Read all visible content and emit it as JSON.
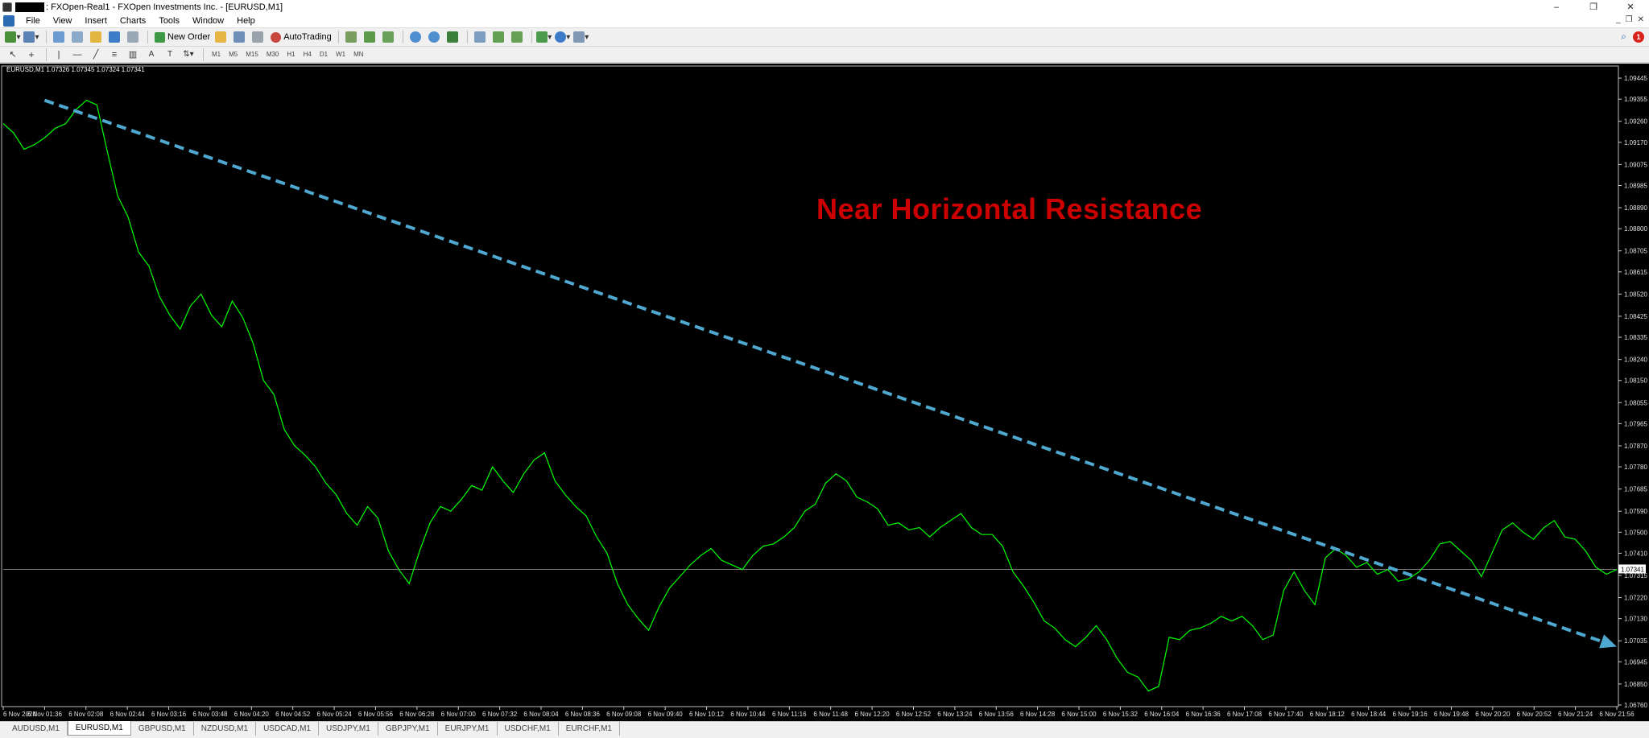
{
  "window": {
    "title": ": FXOpen-Real1 - FXOpen Investments Inc. - [EURUSD,M1]",
    "minimize": "–",
    "restore": "❐",
    "close": "✕"
  },
  "menu": [
    "File",
    "View",
    "Insert",
    "Charts",
    "Tools",
    "Window",
    "Help"
  ],
  "toolbar": {
    "new_order": "New Order",
    "auto_trading": "AutoTrading",
    "notification_count": "1"
  },
  "timeframes": [
    "M1",
    "M5",
    "M15",
    "M30",
    "H1",
    "H4",
    "D1",
    "W1",
    "MN"
  ],
  "chart_header": "EURUSD,M1  1.07326 1.07345 1.07324 1.07341",
  "annotation": "Near Horizontal Resistance",
  "chart_data": {
    "type": "line",
    "symbol": "EURUSD,M1",
    "current_price": "1.07341",
    "price_levels": [
      "1.09445",
      "1.09355",
      "1.09260",
      "1.09170",
      "1.09075",
      "1.08985",
      "1.08890",
      "1.08800",
      "1.08705",
      "1.08615",
      "1.08520",
      "1.08425",
      "1.08335",
      "1.08240",
      "1.08150",
      "1.08055",
      "1.07965",
      "1.07870",
      "1.07780",
      "1.07685",
      "1.07590",
      "1.07500",
      "1.07410",
      "1.07315",
      "1.07220",
      "1.07130",
      "1.07035",
      "1.06945",
      "1.06850",
      "1.06760"
    ],
    "time_labels": [
      "6 Nov 2024",
      "6 Nov 01:36",
      "6 Nov 02:08",
      "6 Nov 02:44",
      "6 Nov 03:16",
      "6 Nov 03:48",
      "6 Nov 04:20",
      "6 Nov 04:52",
      "6 Nov 05:24",
      "6 Nov 05:56",
      "6 Nov 06:28",
      "6 Nov 07:00",
      "6 Nov 07:32",
      "6 Nov 08:04",
      "6 Nov 08:36",
      "6 Nov 09:08",
      "6 Nov 09:40",
      "6 Nov 10:12",
      "6 Nov 10:44",
      "6 Nov 11:16",
      "6 Nov 11:48",
      "6 Nov 12:20",
      "6 Nov 12:52",
      "6 Nov 13:24",
      "6 Nov 13:56",
      "6 Nov 14:28",
      "6 Nov 15:00",
      "6 Nov 15:32",
      "6 Nov 16:04",
      "6 Nov 16:36",
      "6 Nov 17:08",
      "6 Nov 17:40",
      "6 Nov 18:12",
      "6 Nov 18:44",
      "6 Nov 19:16",
      "6 Nov 19:48",
      "6 Nov 20:20",
      "6 Nov 20:52",
      "6 Nov 21:24",
      "6 Nov 21:56"
    ],
    "ylim": [
      1.0676,
      1.0949
    ],
    "series": [
      {
        "values": [
          1.0925,
          1.0921,
          1.0914,
          1.0916,
          1.0919,
          1.0923,
          1.0925,
          1.0931,
          1.0935,
          1.0933,
          1.0913,
          1.0894,
          1.0885,
          1.087,
          1.0864,
          1.0851,
          1.0843,
          1.0837,
          1.0847,
          1.0852,
          1.0843,
          1.0838,
          1.0849,
          1.0842,
          1.0831,
          1.0815,
          1.0809,
          1.0794,
          1.0787,
          1.0783,
          1.0778,
          1.0771,
          1.0766,
          1.0758,
          1.0753,
          1.0761,
          1.0756,
          1.0742,
          1.0734,
          1.0728,
          1.0742,
          1.0754,
          1.0761,
          1.0759,
          1.0764,
          1.077,
          1.0768,
          1.0778,
          1.0772,
          1.0767,
          1.0775,
          1.0781,
          1.0784,
          1.0772,
          1.0766,
          1.0761,
          1.0757,
          1.0748,
          1.0741,
          1.0728,
          1.0719,
          1.0713,
          1.0708,
          1.0718,
          1.0726,
          1.0731,
          1.0736,
          1.074,
          1.0743,
          1.0738,
          1.0736,
          1.0734,
          1.074,
          1.0744,
          1.0745,
          1.0748,
          1.0752,
          1.0759,
          1.0762,
          1.0771,
          1.0775,
          1.0772,
          1.0765,
          1.0763,
          1.076,
          1.0753,
          1.0754,
          1.0751,
          1.0752,
          1.0748,
          1.0752,
          1.0755,
          1.0758,
          1.0752,
          1.0749,
          1.0749,
          1.0744,
          1.0733,
          1.0727,
          1.072,
          1.0712,
          1.0709,
          1.0704,
          1.0701,
          1.0705,
          1.071,
          1.0704,
          1.0696,
          1.069,
          1.0688,
          1.0682,
          1.0684,
          1.0705,
          1.0704,
          1.0708,
          1.0709,
          1.0711,
          1.0714,
          1.0712,
          1.0714,
          1.071,
          1.0704,
          1.0706,
          1.0725,
          1.0733,
          1.0725,
          1.0719,
          1.0739,
          1.0743,
          1.074,
          1.0735,
          1.0737,
          1.0732,
          1.0734,
          1.0729,
          1.073,
          1.0733,
          1.0738,
          1.0745,
          1.0746,
          1.0742,
          1.0738,
          1.0731,
          1.0741,
          1.0751,
          1.0754,
          1.075,
          1.0747,
          1.0752,
          1.0755,
          1.0748,
          1.0747,
          1.0742,
          1.0735,
          1.0732,
          1.0734
        ]
      }
    ],
    "trendline": {
      "start": [
        "6 Nov 01:36",
        1.0935
      ],
      "end": [
        "6 Nov 21:56",
        1.0701
      ],
      "style": "dashed",
      "arrow": true
    }
  },
  "tabs": [
    "AUDUSD,M1",
    "EURUSD,M1",
    "GBPUSD,M1",
    "NZDUSD,M1",
    "USDCAD,M1",
    "USDJPY,M1",
    "GBPJPY,M1",
    "EURJPY,M1",
    "USDCHF,M1",
    "EURCHF,M1"
  ],
  "active_tab": "EURUSD,M1",
  "colors": {
    "chart_bg": "#000000",
    "price_line": "#00ff00",
    "trendline": "#4fa8d0",
    "annotation": "#cc0000",
    "bid_line": "#7a7a7a"
  }
}
